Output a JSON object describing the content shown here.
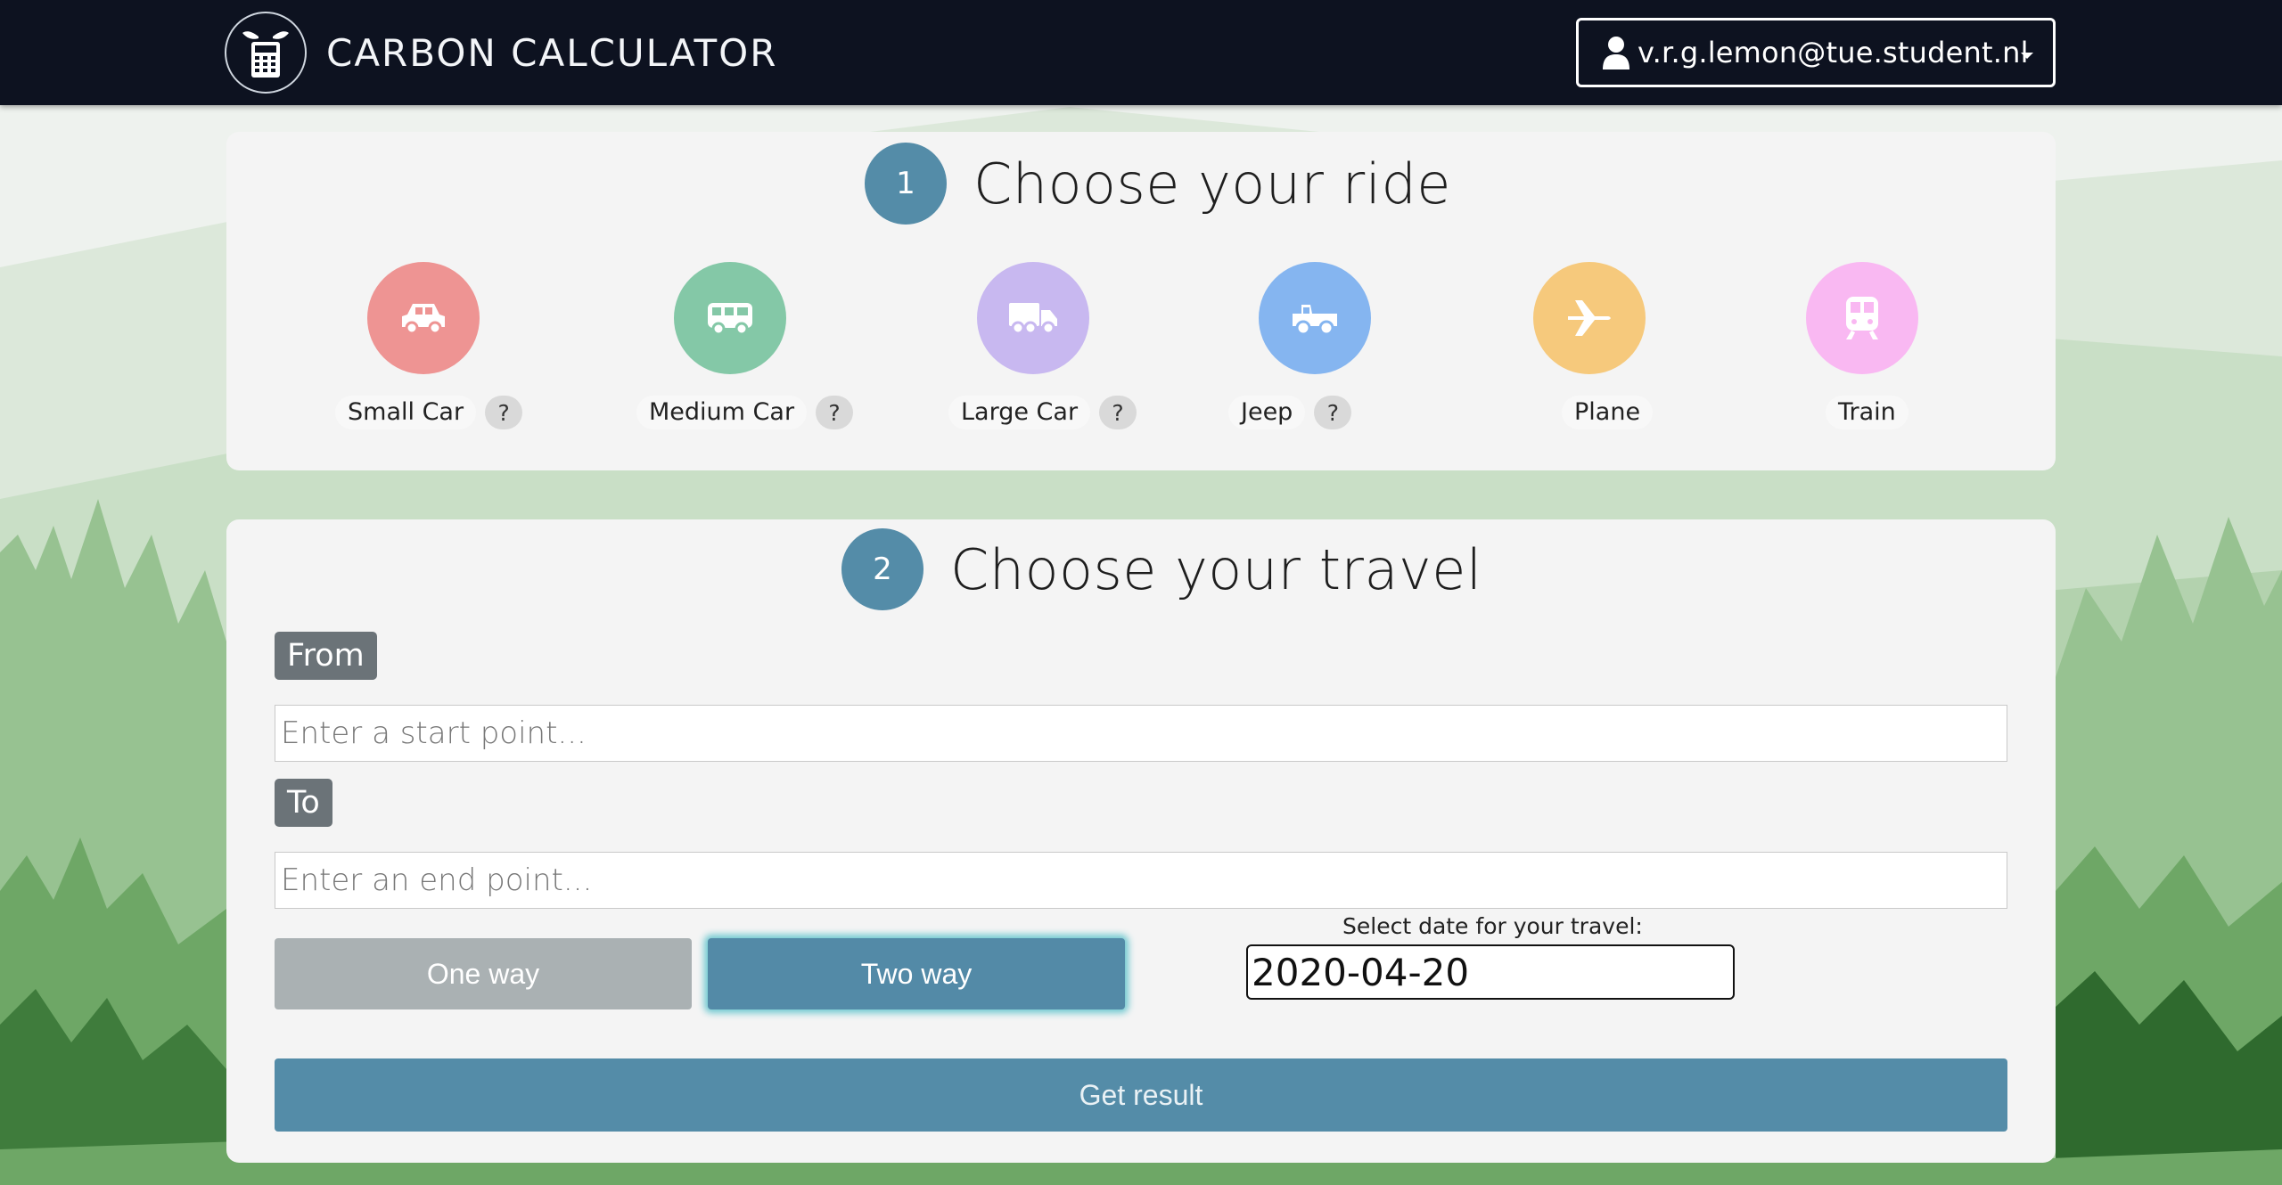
{
  "header": {
    "title": "CARBON CALCULATOR",
    "user_email": "v.r.g.lemon@tue.student.nl"
  },
  "step1": {
    "number": "1",
    "title": "Choose your ride",
    "vehicles": [
      {
        "label": "Small Car",
        "help": "?",
        "color": "#ee9493",
        "icon": "car-icon"
      },
      {
        "label": "Medium Car",
        "help": "?",
        "color": "#84c8a7",
        "icon": "van-icon"
      },
      {
        "label": "Large Car",
        "help": "?",
        "color": "#c8b8f0",
        "icon": "truck-icon"
      },
      {
        "label": "Jeep",
        "help": "?",
        "color": "#85b5f0",
        "icon": "jeep-icon"
      },
      {
        "label": "Plane",
        "help": "",
        "color": "#f6c97c",
        "icon": "plane-icon"
      },
      {
        "label": "Train",
        "help": "",
        "color": "#f9b8f2",
        "icon": "train-icon"
      }
    ]
  },
  "step2": {
    "number": "2",
    "title": "Choose your travel",
    "from_label": "From",
    "from_placeholder": "Enter a start point...",
    "to_label": "To",
    "to_placeholder": "Enter an end point...",
    "one_way_label": "One way",
    "two_way_label": "Two way",
    "date_label": "Select date for your travel:",
    "date_value": "2020-04-20",
    "submit_label": "Get result"
  },
  "colors": {
    "navbar": "#0d1220",
    "accent": "#548ca8",
    "card": "#f4f4f4"
  }
}
